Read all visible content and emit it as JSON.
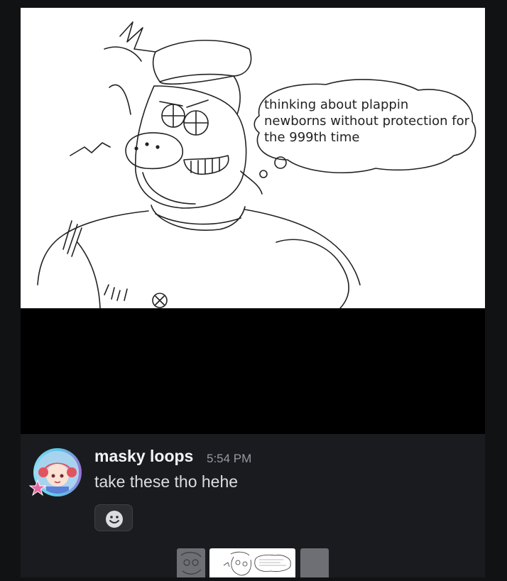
{
  "comic": {
    "bubble_text": "thinking about plappin newborns without protection for the 999th time"
  },
  "message": {
    "author": "masky loops",
    "timestamp": "5:54 PM",
    "text": "take these tho hehe"
  },
  "icons": {
    "add_reaction": "smiley-face-icon",
    "avatar_badge": "star-icon"
  },
  "colors": {
    "background": "#111214",
    "message_bg": "#1a1b1e",
    "author": "#f2f3f5",
    "timestamp": "#949ba4"
  }
}
